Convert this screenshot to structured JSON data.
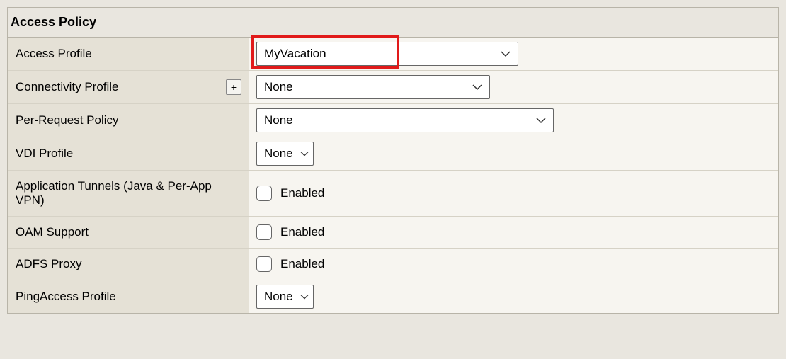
{
  "section_title": "Access Policy",
  "rows": {
    "access_profile": {
      "label": "Access Profile",
      "value": "MyVacation"
    },
    "connectivity_profile": {
      "label": "Connectivity Profile",
      "value": "None",
      "add_label": "+"
    },
    "per_request_policy": {
      "label": "Per-Request Policy",
      "value": "None"
    },
    "vdi_profile": {
      "label": "VDI Profile",
      "value": "None"
    },
    "app_tunnels": {
      "label": "Application Tunnels (Java & Per-App VPN)",
      "checkbox_label": "Enabled"
    },
    "oam_support": {
      "label": "OAM Support",
      "checkbox_label": "Enabled"
    },
    "adfs_proxy": {
      "label": "ADFS Proxy",
      "checkbox_label": "Enabled"
    },
    "pingaccess_profile": {
      "label": "PingAccess Profile",
      "value": "None"
    }
  }
}
